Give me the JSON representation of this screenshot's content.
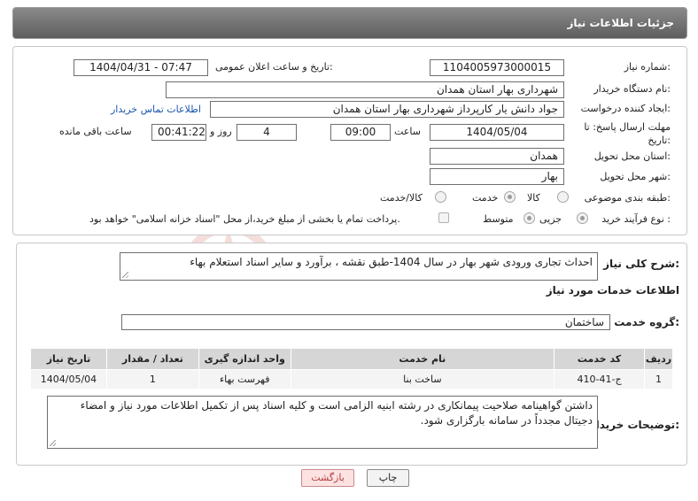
{
  "header": {
    "title": "جزئیات اطلاعات نیاز"
  },
  "form": {
    "need_number": {
      "label": "شماره نیاز:",
      "value": "1104005973000015"
    },
    "announce_datetime": {
      "label": "تاریخ و ساعت اعلان عمومی:",
      "value": "1404/04/31 - 07:47"
    },
    "buyer_org": {
      "label": "نام دستگاه خریدار:",
      "value": "شهرداری بهار استان همدان"
    },
    "requester": {
      "label": "ایجاد کننده درخواست:",
      "value": "جواد دانش یار کارپرداز شهرداری بهار استان همدان",
      "contact_link": "اطلاعات تماس خریدار"
    },
    "deadline": {
      "label_line1": "مهلت ارسال پاسخ: تا",
      "label_line2": "تاریخ:",
      "date": "1404/05/04",
      "time_label": "ساعت",
      "time": "09:00",
      "days": "4",
      "days_label": "روز و",
      "remaining": "00:41:22",
      "remaining_label": "ساعت باقی مانده"
    },
    "province": {
      "label": "استان محل تحویل:",
      "value": "همدان"
    },
    "city": {
      "label": "شهر محل تحویل:",
      "value": "بهار"
    },
    "category": {
      "label": "طبقه بندی موضوعی:",
      "options": [
        "کالا",
        "خدمت",
        "کالا/خدمت"
      ],
      "selected": "خدمت"
    },
    "process": {
      "label": "نوع فرآیند خرید :",
      "options": [
        "جزیی",
        "متوسط"
      ],
      "selected": "جزیی",
      "payment_note": "پرداخت تمام یا بخشی از مبلغ خرید،از محل \"اسناد خزانه اسلامی\" خواهد بود."
    }
  },
  "need": {
    "summary_label": "شرح کلی نیاز:",
    "summary": "احداث تجاری ورودی شهر بهار در سال 1404-طبق نقشه ، برآورد و سایر اسناد استعلام بهاء",
    "services_title": "اطلاعات خدمات مورد نیاز",
    "service_group_label": "گروه خدمت:",
    "service_group": "ساختمان",
    "table": {
      "headers": [
        "ردیف",
        "کد خدمت",
        "نام خدمت",
        "واحد اندازه گیری",
        "تعداد / مقدار",
        "تاریخ نیاز"
      ],
      "rows": [
        [
          "1",
          "ج-41-410",
          "ساخت بنا",
          "فهرست بهاء",
          "1",
          "1404/05/04"
        ]
      ]
    },
    "buyer_notes_label": "توضیحات خریدار:",
    "buyer_notes": "داشتن گواهینامه صلاحیت پیمانکاری در رشته ابنیه الزامی است و کلیه اسناد پس از تکمیل اطلاعات مورد نیاز و امضاء دجیتال مجدداً در سامانه بارگزاری شود."
  },
  "buttons": {
    "print": "چاپ",
    "back": "بازگشت"
  },
  "colors": {
    "header": "#6e6e6e",
    "link": "#1a55b0",
    "back_button": "#fde2e2",
    "watermark": "#c0392b"
  }
}
